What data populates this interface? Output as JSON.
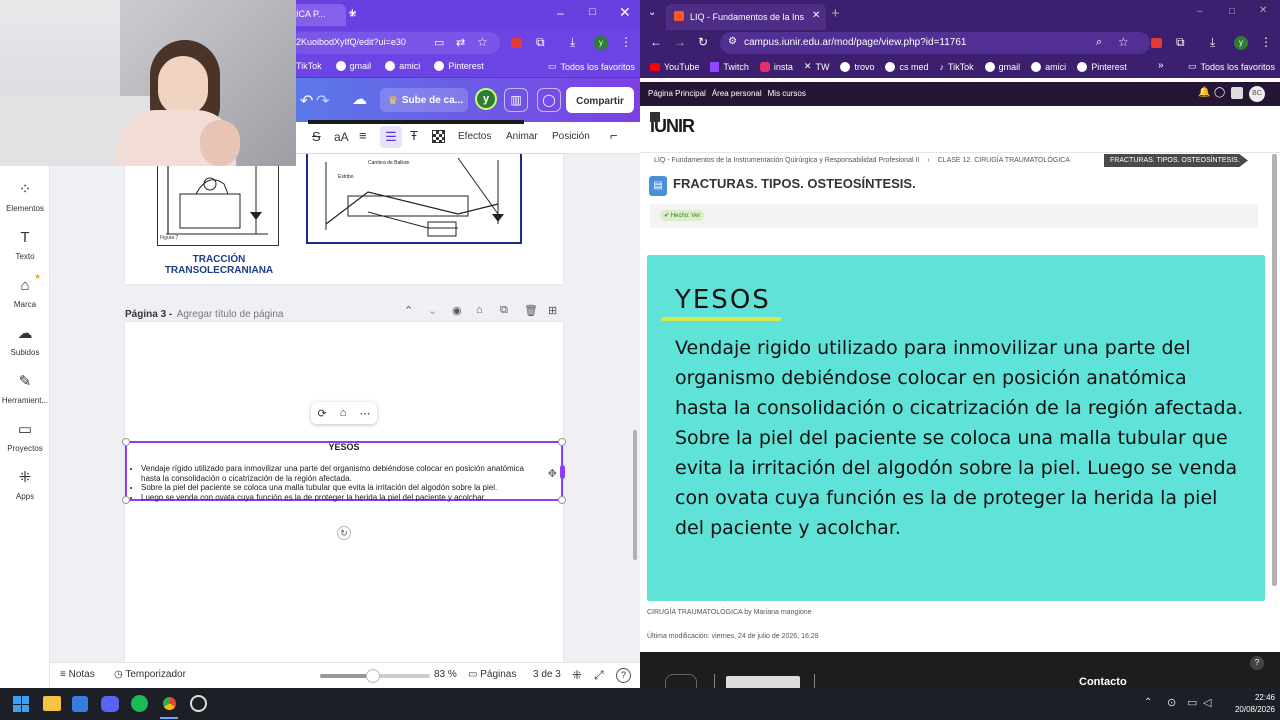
{
  "left_browser": {
    "tab_title": "ICA P...",
    "url": "2KuoibodXyIfQ/edit?ui=e30",
    "bookmarks": [
      "TikTok",
      "gmail",
      "amici",
      "Pinterest"
    ],
    "all_bookmarks": "Todos los favoritos",
    "profile_initial": "y"
  },
  "canva": {
    "upload_button": "Sube de ca...",
    "share_button": "Compartir",
    "avatar_initial": "y",
    "toolbar": {
      "effects": "Efectos",
      "animate": "Animar",
      "position": "Posición",
      "font_size": "aA"
    },
    "sidebar": [
      {
        "label": "Elementos",
        "icon": "elements-icon"
      },
      {
        "label": "Texto",
        "icon": "text-icon"
      },
      {
        "label": "Marca",
        "icon": "brand-icon"
      },
      {
        "label": "Subidos",
        "icon": "upload-icon"
      },
      {
        "label": "Herramient...",
        "icon": "tools-icon"
      },
      {
        "label": "Proyectos",
        "icon": "folder-icon"
      },
      {
        "label": "Apps",
        "icon": "apps-icon"
      }
    ],
    "page2_caption_line1": "TRACCIÓN",
    "page2_caption_line2": "TRANSOLECRANIANA",
    "page2_figure_label": "Figura 7",
    "page3_label": "Página 3 -",
    "page3_title_placeholder": "Agregar título de página",
    "textbox_title": "YESOS",
    "bullets": [
      "Vendaje rígido utilizado para inmovilizar una parte del organismo debiéndose colocar en posición anatómica hasta la consolidación o cicatrización de la región afectada.",
      "Sobre la piel del paciente se coloca una malla tubular que evita la irritación del algodón sobre la piel.",
      "Luego se venda con ovata cuya función es la de proteger la herida la piel del paciente y acolchar."
    ],
    "bottom": {
      "notes": "Notas",
      "timer": "Temporizador",
      "zoom": "83 %",
      "pages": "Páginas",
      "page_count": "3 de 3",
      "zoom_fraction": 0.48
    }
  },
  "right_browser": {
    "tab_title": "LIQ - Fundamentos de la Instru",
    "url": "campus.iunir.edu.ar/mod/page/view.php?id=11761",
    "bookmarks": [
      "YouTube",
      "Twitch",
      "insta",
      "TW",
      "trovo",
      "cs med",
      "TikTok",
      "gmail",
      "amici",
      "Pinterest"
    ],
    "all_bookmarks": "Todos los favoritos",
    "profile_initial": "y",
    "nav": [
      "Página Principal",
      "Área personal",
      "Mis cursos"
    ],
    "user_initials": "BC"
  },
  "campus": {
    "logo_text": "IUNIR",
    "breadcrumb": [
      "LIQ - Fundamentos de la Instrumentación Quirúrgica y Responsabilidad Profesional II",
      "CLASE 12. CIRUGÍA TRAUMATOLÓGICA",
      "FRACTURAS. TIPOS. OSTEOSÍNTESIS."
    ],
    "page_title": "FRACTURAS. TIPOS. OSTEOSÍNTESIS.",
    "done_badge": "✔ Hecho: Ver",
    "card_title": "YESOS",
    "card_text_1": "Vendaje rigido utilizado para inmovilizar una parte del organismo debiéndose colocar en posición anatómica hasta la consolidación o cicatrización de la región afectada.",
    "card_text_2": "Sobre la piel del paciente se coloca una malla tubular que evita la irritación del algodón sobre la piel. Luego se venda con ovata cuya función es la de proteger la herida la piel del paciente y acolchar.",
    "credit": "CIRUGÍA TRAUMATOLÓGICA by Mariana mangione",
    "last_modified": "Última modificación: viernes, 24 de julio de 2026, 16:28",
    "footer_contact": "Contacto",
    "card_color": "#5fe3d8"
  },
  "taskbar": {
    "time": "22:46",
    "date": "20/08/2026"
  }
}
